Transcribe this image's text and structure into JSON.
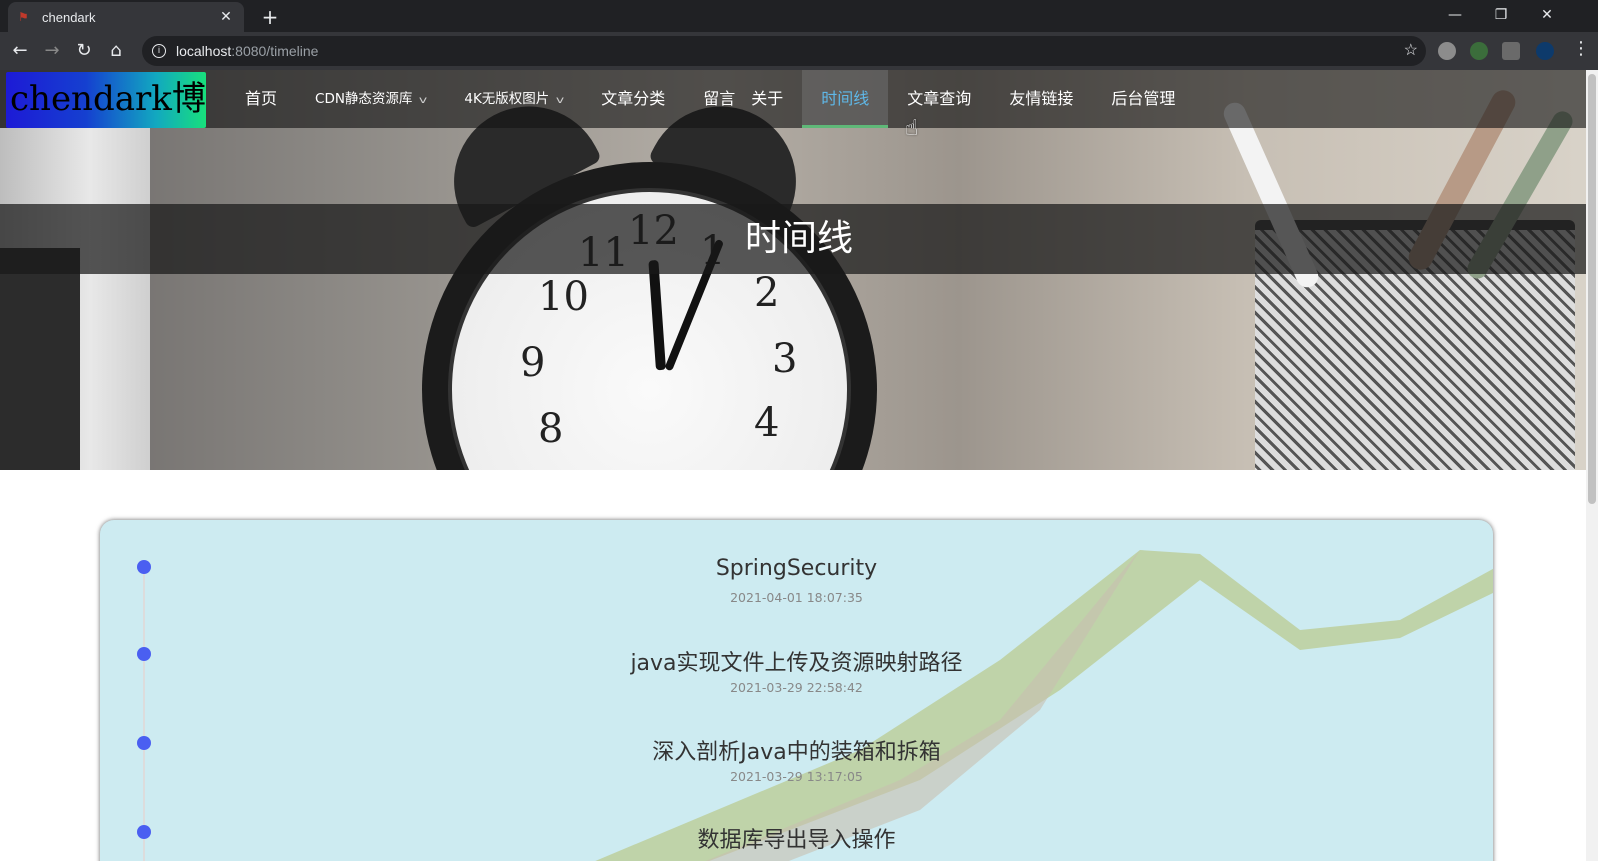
{
  "browser": {
    "tab_title": "chendark",
    "tab_close": "✕",
    "new_tab": "+",
    "url_host": "localhost",
    "url_path": ":8080/timeline",
    "window_controls": {
      "minimize": "—",
      "restore": "❐",
      "close": "✕"
    }
  },
  "site": {
    "logo_text": "chendark博客",
    "nav": [
      {
        "label": "首页"
      },
      {
        "label": "CDN静态资源库",
        "dropdown": true
      },
      {
        "label": "4K无版权图片",
        "dropdown": true
      },
      {
        "label": "文章分类"
      },
      {
        "label": "留言"
      },
      {
        "label": "关于"
      },
      {
        "label": "时间线",
        "active": true
      },
      {
        "label": "文章查询"
      },
      {
        "label": "友情链接"
      },
      {
        "label": "后台管理"
      }
    ],
    "page_title": "时间线",
    "accent_color": "#5fb8e8",
    "dot_color": "#4a5ff1"
  },
  "timeline": [
    {
      "title": "SpringSecurity",
      "date": "2021-04-01 18:07:35"
    },
    {
      "title": "java实现文件上传及资源映射路径",
      "date": "2021-03-29 22:58:42"
    },
    {
      "title": "深入剖析Java中的装箱和拆箱",
      "date": "2021-03-29 13:17:05"
    },
    {
      "title": "数据库导出导入操作",
      "date": ""
    }
  ],
  "clock_numbers": [
    "12",
    "11",
    "1",
    "10",
    "2",
    "9",
    "3",
    "8",
    "4"
  ]
}
